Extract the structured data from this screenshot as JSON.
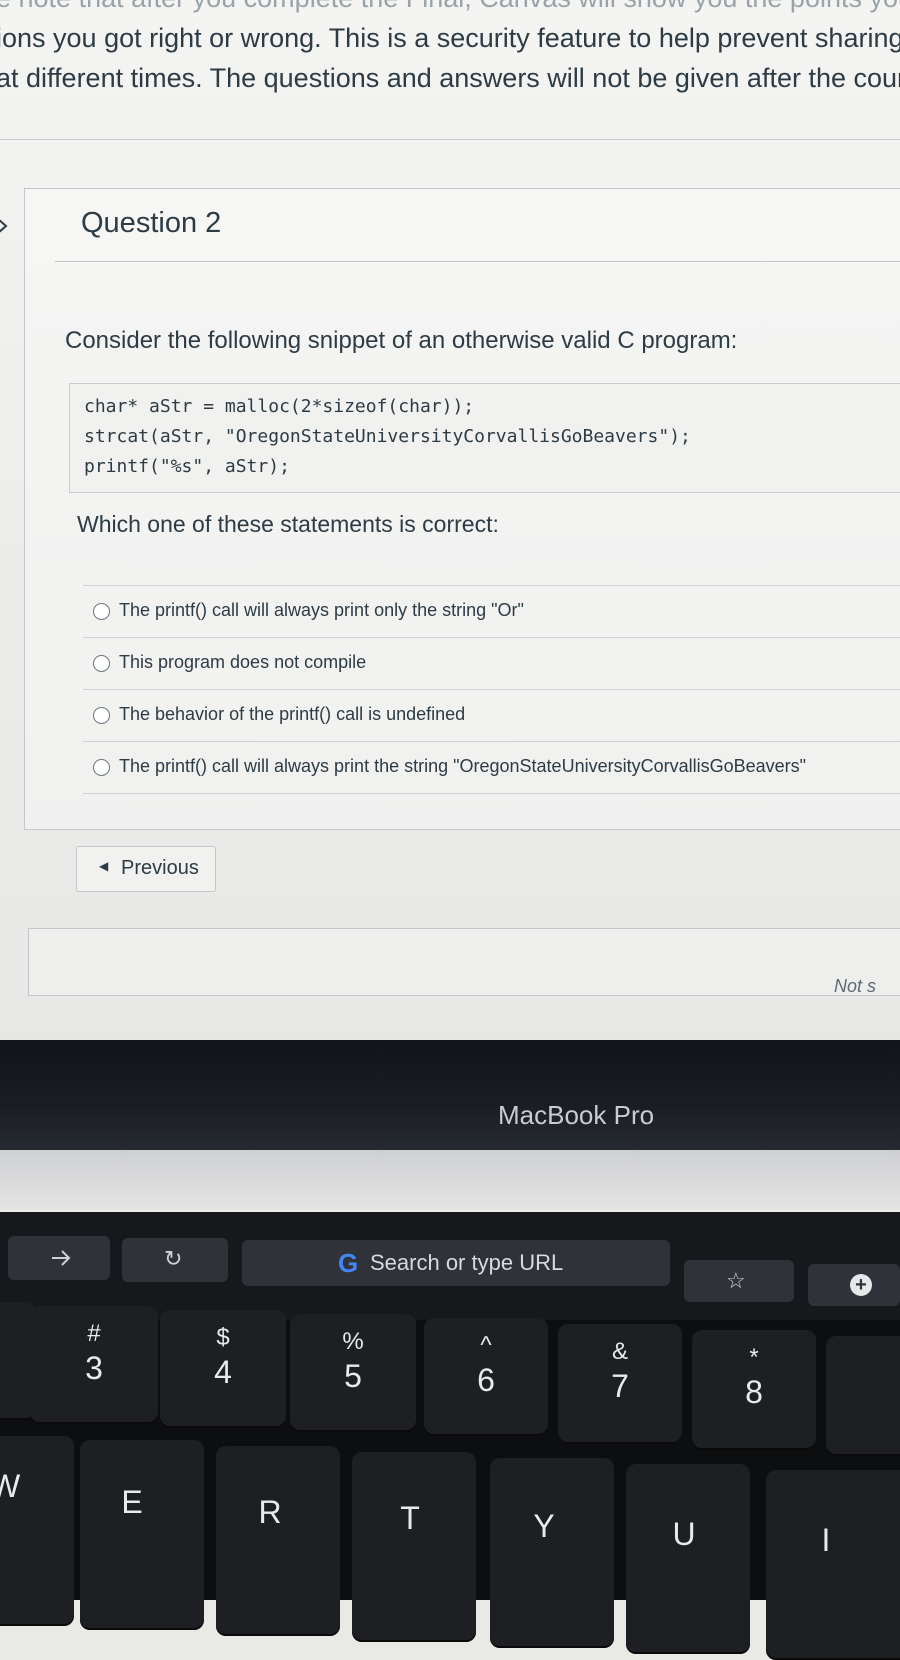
{
  "notice": {
    "line0": "e note that after you complete the Final, Canvas will show you the points you scor",
    "line1": "ions you got right or wrong. This is a security feature to help prevent sharing answer",
    "line2": "at different times. The questions and answers will not be given after the course en"
  },
  "question": {
    "title": "Question 2",
    "prompt": "Consider the following snippet of an otherwise valid C program:",
    "code": [
      "char* aStr = malloc(2*sizeof(char));",
      "strcat(aStr, \"OregonStateUniversityCorvallisGoBeavers\");",
      "printf(\"%s\", aStr);"
    ],
    "ask": "Which one of these statements is correct:",
    "answers": [
      "The printf() call will always print only the string \"Or\"",
      "This program does not compile",
      "The behavior of the printf() call is undefined",
      "The printf() call will always print the string \"OregonStateUniversityCorvallisGoBeavers\""
    ]
  },
  "nav": {
    "previous_label": "Previous"
  },
  "footer": {
    "status_text": "Not s"
  },
  "laptop": {
    "bezel_label": "MacBook Pro"
  },
  "touchbar": {
    "url_placeholder": "Search or type URL",
    "icons": [
      "forward-arrow-icon",
      "reload-icon",
      "google-icon",
      "star-icon",
      "plus-icon"
    ]
  },
  "keyboard": {
    "number_row": [
      {
        "sym": "#",
        "num": "3"
      },
      {
        "sym": "$",
        "num": "4"
      },
      {
        "sym": "%",
        "num": "5"
      },
      {
        "sym": "^",
        "num": "6"
      },
      {
        "sym": "&",
        "num": "7"
      },
      {
        "sym": "*",
        "num": "8"
      }
    ],
    "letter_row": [
      "W",
      "E",
      "R",
      "T",
      "Y",
      "U",
      "I"
    ]
  },
  "colors": {
    "text": "#2d3b45",
    "bezel": "#11141b",
    "touchbar": "#16181c",
    "key": "#1d1f22"
  }
}
